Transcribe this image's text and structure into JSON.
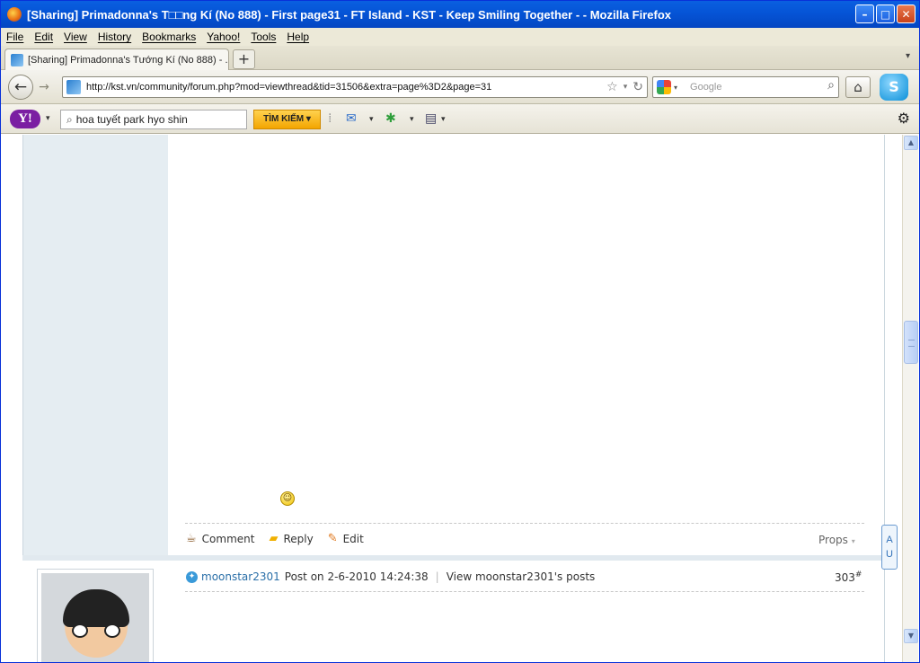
{
  "window": {
    "title": "[Sharing] Primadonna's T□□ng Kí (No 888) - First page31 - FT Island - KST - Keep Smiling Together - - Mozilla Firefox",
    "minimize_label": "–",
    "maximize_label": "□",
    "close_label": "✕"
  },
  "menubar": {
    "items": [
      "File",
      "Edit",
      "View",
      "History",
      "Bookmarks",
      "Yahoo!",
      "Tools",
      "Help"
    ]
  },
  "tabs": [
    {
      "label": "[Sharing] Primadonna's Tướng Kí (No 888) - ..."
    }
  ],
  "navbar": {
    "url": "http://kst.vn/community/forum.php?mod=viewthread&tid=31506&extra=page%3D2&page=31",
    "search_placeholder": "Google"
  },
  "yahoo_toolbar": {
    "logo": "Y!",
    "search_value": "hoa tuyết park hyo shin",
    "search_button": "TÌM KIẾM"
  },
  "post_actions": {
    "comment": "Comment",
    "reply": "Reply",
    "edit": "Edit",
    "props": "Props"
  },
  "next_post": {
    "author": "moonstar2301",
    "posted": "Post on 2-6-2010 14:24:38",
    "view_posts": "View moonstar2301's posts",
    "number": "303",
    "number_suffix": "#"
  },
  "side_widget": {
    "label": "A\nU"
  },
  "icons": {
    "back": "arrow-left-icon",
    "forward": "arrow-right-icon",
    "home": "home-icon",
    "reload": "reload-icon",
    "bookmark_star": "star-icon",
    "search": "magnifier-icon",
    "gear": "gear-icon",
    "mail": "mail-icon",
    "smiley": "smiley-icon"
  },
  "colors": {
    "titlebar": "#0554d6",
    "author_link": "#2a6fa8",
    "sidebar_bg": "#e5edf2",
    "yahoo_button": "#f3a500"
  }
}
